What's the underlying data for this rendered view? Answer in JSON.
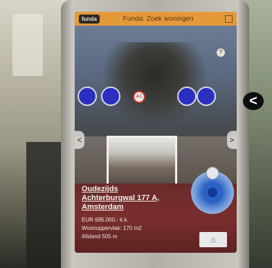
{
  "app": {
    "brand_label": "funda",
    "title": "Funda: Zoek woningen"
  },
  "camera_view": {
    "poi_badge": "A1",
    "navigation": {
      "prev_label": "<",
      "next_label": ">"
    }
  },
  "property": {
    "address_line1": "Oudezijds",
    "address_line2": "Achterburgwal 177 A,",
    "city": "Amsterdam",
    "price": "EUR 695.000,- k.k.",
    "living_area": "Woonoppervlak: 170 m2",
    "distance": "Afstand 505 m"
  },
  "controls": {
    "home_icon": "home-icon",
    "side_badge_label": "<"
  },
  "colors": {
    "title_bar": "#e59a3a",
    "info_panel": "#6a2a2a",
    "poi_blue": "#2a2fbf",
    "radar_blue": "#2f6fd0"
  }
}
